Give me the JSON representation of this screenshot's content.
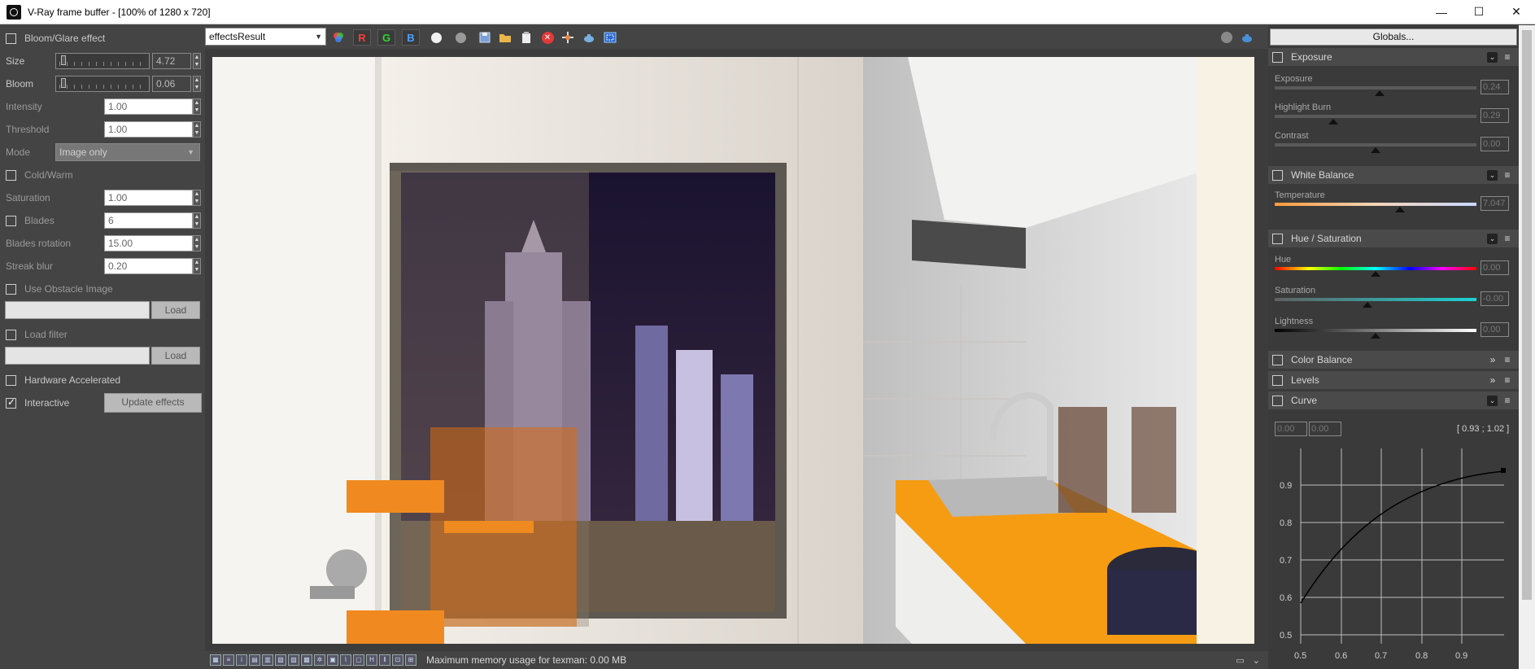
{
  "window": {
    "title": "V-Ray frame buffer - [100% of 1280 x 720]",
    "controls": [
      "—",
      "☐",
      "✕"
    ]
  },
  "left_panel": {
    "bloom_glare": {
      "label": "Bloom/Glare effect",
      "checked": false
    },
    "size": {
      "label": "Size",
      "value": "4.72"
    },
    "bloom": {
      "label": "Bloom",
      "value": "0.06"
    },
    "intensity": {
      "label": "Intensity",
      "value": "1.00"
    },
    "threshold": {
      "label": "Threshold",
      "value": "1.00"
    },
    "mode": {
      "label": "Mode",
      "value": "Image only"
    },
    "cold_warm": {
      "label": "Cold/Warm",
      "checked": false
    },
    "saturation": {
      "label": "Saturation",
      "value": "1.00"
    },
    "blades": {
      "label": "Blades",
      "value": "6",
      "checked": false
    },
    "blades_rotation": {
      "label": "Blades rotation",
      "value": "15.00"
    },
    "streak_blur": {
      "label": "Streak blur",
      "value": "0.20"
    },
    "use_obstacle": {
      "label": "Use Obstacle Image",
      "checked": false,
      "load": "Load"
    },
    "load_filter": {
      "label": "Load filter",
      "checked": false,
      "load": "Load"
    },
    "hardware_accel": {
      "label": "Hardware Accelerated",
      "checked": false
    },
    "interactive": {
      "label": "Interactive",
      "checked": true
    },
    "update_effects": "Update effects"
  },
  "toolbar": {
    "channel": "effectsResult",
    "r": "R",
    "g": "G",
    "b": "B"
  },
  "status": {
    "message": "Maximum memory usage for texman: 0.00 MB",
    "icon_h": "H"
  },
  "right_panel": {
    "globals": "Globals...",
    "exposure_section": {
      "title": "Exposure",
      "sliders": [
        {
          "label": "Exposure",
          "value": "0.24",
          "position": 0.52
        },
        {
          "label": "Highlight Burn",
          "value": "0.29",
          "position": 0.29
        },
        {
          "label": "Contrast",
          "value": "0.00",
          "position": 0.5
        }
      ]
    },
    "white_balance": {
      "title": "White Balance",
      "sliders": [
        {
          "label": "Temperature",
          "value": "7.047",
          "position": 0.62
        }
      ]
    },
    "hue_saturation": {
      "title": "Hue / Saturation",
      "sliders": [
        {
          "label": "Hue",
          "value": "0.00",
          "position": 0.5
        },
        {
          "label": "Saturation",
          "value": "-0.00",
          "position": 0.46
        },
        {
          "label": "Lightness",
          "value": "0.00",
          "position": 0.5
        }
      ]
    },
    "color_balance": {
      "title": "Color Balance"
    },
    "levels": {
      "title": "Levels"
    },
    "curve": {
      "title": "Curve",
      "input_x": "0.00",
      "input_y": "0.00",
      "readout": "[ 0.93 ; 1.02 ]",
      "x_ticks": [
        "0.5",
        "0.6",
        "0.7",
        "0.8",
        "0.9"
      ],
      "y_ticks": [
        "0.9",
        "0.8",
        "0.7",
        "0.6",
        "0.5"
      ]
    }
  }
}
